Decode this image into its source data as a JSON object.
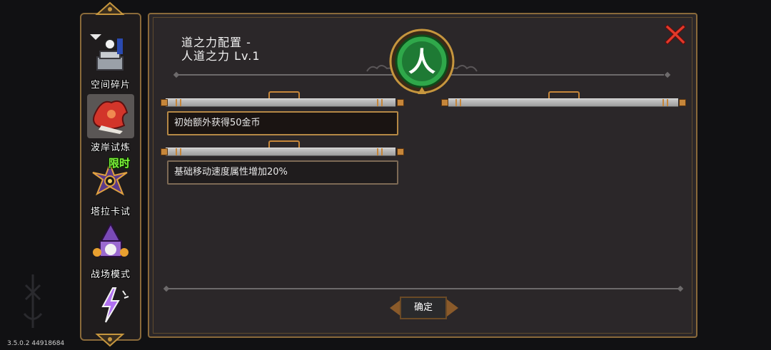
{
  "sidebar": {
    "items": [
      {
        "label": "空间碎片",
        "icon": "space-fragment-icon",
        "active": false
      },
      {
        "label": "波岸试炼",
        "icon": "wave-shore-trial-icon",
        "active": true
      },
      {
        "label": "塔拉卡试",
        "icon": "taraka-trial-icon",
        "active": false,
        "badge": "限时"
      },
      {
        "label": "战场模式",
        "icon": "battlefield-mode-icon",
        "active": false
      },
      {
        "label": "",
        "icon": "lightning-icon",
        "active": false
      }
    ]
  },
  "panel": {
    "title_line1": "道之力配置 -",
    "title_line2": "人道之力 Lv.1",
    "emblem_char": "人",
    "effects": [
      "初始额外获得50金币",
      "基础移动速度属性增加20%"
    ],
    "confirm_label": "确定"
  },
  "version": "3.5.0.2 44918684",
  "colors": {
    "accent_gold": "#b58845",
    "close_red": "#e23a2a",
    "emblem_green": "#2fa84a",
    "limited_green": "#7df53a"
  }
}
